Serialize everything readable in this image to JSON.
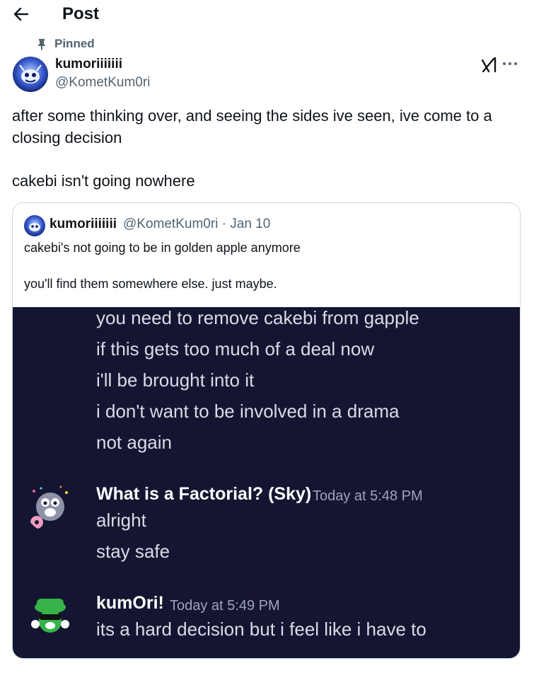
{
  "header": {
    "title": "Post",
    "back_icon": "arrow-left-icon"
  },
  "post": {
    "pinned_label": "Pinned",
    "author_name": "kumoriiiiiii",
    "author_handle": "@KometKum0ri",
    "text_line1": "after some thinking over, and seeing the sides ive seen, ive come to a closing decision",
    "text_line2": "cakebi isn't going nowhere",
    "icons": [
      "pin-icon",
      "grok-icon",
      "more-icon"
    ]
  },
  "quote": {
    "author_name": "kumoriiiiiii",
    "meta": "@KometKum0ri · Jan 10",
    "text_line1": "cakebi's not going to be in golden apple anymore",
    "text_line2": "you'll find them somewhere else. just maybe.",
    "image": {
      "messages_top": [
        "you need to remove cakebi from gapple",
        "if this gets too much of a deal now",
        "i'll be brought into it",
        "i don't want to  be involved in a drama",
        "not again"
      ],
      "msg1": {
        "author": "What is a Factorial? (Sky)",
        "time": "Today at 5:48 PM",
        "lines": [
          "alright",
          "stay safe"
        ]
      },
      "msg2": {
        "author": "kumOri!",
        "time": "Today at 5:49 PM",
        "lines": [
          "its a hard decision but i feel like i have to"
        ]
      }
    }
  },
  "colors": {
    "text": "#0f1419",
    "secondary": "#536471",
    "border": "#cfd9de",
    "discord_bg": "#141631"
  }
}
